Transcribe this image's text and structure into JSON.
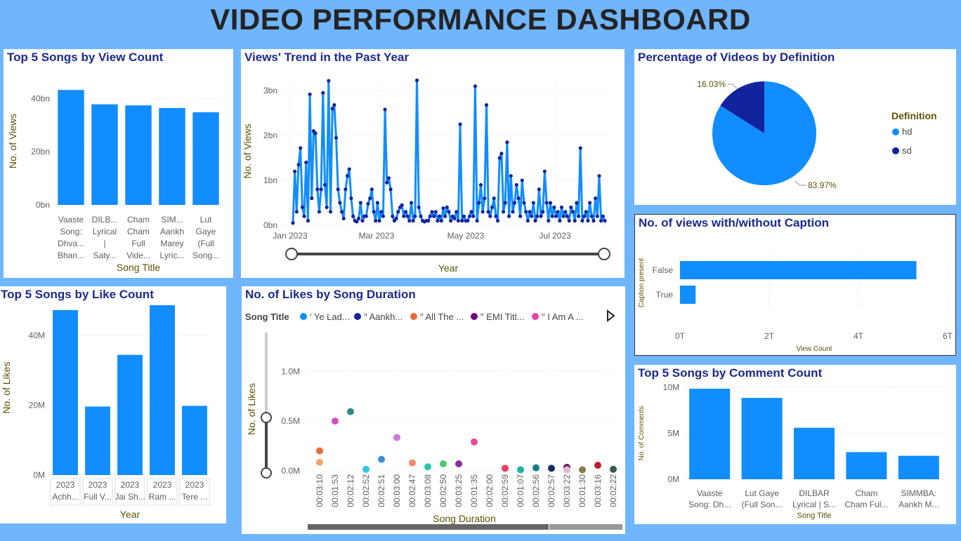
{
  "dashboard": {
    "title": "VIDEO PERFORMANCE DASHBOARD"
  },
  "colors": {
    "bar": "#118dff",
    "dark": "#12239e",
    "background": "#6fb6ff",
    "title": "#1b2a8f"
  },
  "views_panel": {
    "title": "Top 5 Songs by View Count",
    "chart_data": {
      "type": "bar",
      "xlabel": "Song Title",
      "ylabel": "No. of Views",
      "yticks": [
        "0bn",
        "20bn",
        "40bn"
      ],
      "ylim": [
        0,
        48
      ],
      "categories": [
        [
          "Vaaste",
          "Song:",
          "Dhva...",
          "Bhan..."
        ],
        [
          "DILB...",
          "Lyrical",
          "|",
          "Saty..."
        ],
        [
          "Cham",
          "Cham",
          "Full",
          "Vide..."
        ],
        [
          "SIM...",
          "Aankh",
          "Marey",
          "Lyric..."
        ],
        [
          "Lut",
          "Gaye",
          "(Full",
          "Song..."
        ]
      ],
      "values": [
        43.2,
        37.8,
        37.4,
        36.4,
        34.8
      ]
    }
  },
  "trend_panel": {
    "title": "Views' Trend in the Past Year",
    "chart_data": {
      "type": "line",
      "xlabel": "Year",
      "ylabel": "No. of Views",
      "yticks": [
        "0bn",
        "1bn",
        "2bn",
        "3bn"
      ],
      "ylim": [
        0,
        3.3
      ],
      "xticks": [
        "Jan 2023",
        "Mar 2023",
        "May 2023",
        "Jul 2023"
      ],
      "xlim": [
        "2023-01-01",
        "2023-08-05"
      ],
      "values": [
        0.05,
        1.2,
        0.3,
        1.35,
        1.72,
        0.4,
        0.2,
        1.4,
        0.1,
        2.92,
        0.6,
        2.1,
        2.05,
        0.8,
        0.3,
        0.8,
        2.95,
        0.9,
        0.4,
        3.22,
        0.3,
        2.6,
        2.68,
        1.95,
        0.8,
        0.5,
        0.3,
        0.15,
        0.8,
        1.1,
        1.25,
        0.6,
        0.2,
        0.1,
        0.08,
        0.15,
        0.5,
        0.1,
        0.2,
        0.2,
        0.48,
        0.6,
        0.8,
        0.3,
        0.1,
        0.5,
        0.1,
        0.3,
        0.2,
        2.58,
        0.95,
        1.05,
        0.8,
        0.2,
        0.1,
        0.15,
        0.3,
        0.4,
        0.45,
        0.2,
        0.3,
        0.2,
        0.1,
        0.5,
        0.1,
        0.2,
        3.23,
        0.4,
        0.2,
        0.1,
        0.08,
        0.1,
        0.1,
        0.2,
        0.3,
        0.2,
        0.3,
        0.1,
        0.2,
        0.1,
        0.38,
        0.2,
        0.4,
        0.3,
        0.1,
        0.2,
        0.15,
        0.3,
        0.1,
        2.25,
        0.1,
        0.2,
        0.1,
        0.1,
        0.2,
        0.3,
        0.2,
        3.1,
        0.1,
        0.5,
        0.9,
        0.3,
        0.6,
        2.68,
        0.3,
        0.2,
        0.4,
        0.6,
        0.2,
        0.1,
        1.5,
        1.6,
        0.3,
        0.5,
        1.85,
        0.2,
        1.1,
        0.3,
        0.5,
        0.9,
        0.6,
        0.2,
        1.0,
        0.5,
        0.3,
        0.1,
        0.3,
        0.2,
        0.5,
        0.1,
        0.2,
        0.8,
        0.2,
        0.3,
        1.2,
        0.5,
        0.1,
        0.5,
        0.2,
        0.4,
        0.2,
        0.3,
        0.1,
        0.4,
        0.2,
        0.3,
        0.2,
        0.1,
        0.4,
        0.3,
        0.1,
        0.5,
        0.2,
        1.72,
        0.1,
        0.2,
        0.3,
        0.1,
        0.5,
        0.2,
        0.1,
        0.6,
        0.2,
        1.1,
        0.1,
        0.2,
        0.1
      ]
    }
  },
  "definition_panel": {
    "title": "Percentage of Videos by Definition",
    "legend_title": "Definition",
    "chart_data": {
      "type": "pie",
      "labels": [
        "hd",
        "sd"
      ],
      "values": [
        83.97,
        16.03
      ],
      "value_labels": [
        "83.97%",
        "16.03%"
      ],
      "colors": [
        "#118dff",
        "#12239e"
      ]
    }
  },
  "caption_panel": {
    "title": "No. of views with/without Caption",
    "chart_data": {
      "type": "bar",
      "orientation": "horizontal",
      "xlabel": "View Count",
      "ylabel": "Caption present",
      "categories": [
        "False",
        "True"
      ],
      "values": [
        5.3,
        0.35
      ],
      "xticks": [
        "0T",
        "2T",
        "4T",
        "6T"
      ],
      "xlim": [
        0,
        6
      ]
    }
  },
  "likes_panel": {
    "title": "Top 5 Songs by Like Count",
    "chart_data": {
      "type": "bar",
      "xlabel": "Year",
      "ylabel": "No. of Likes",
      "yticks": [
        "0M",
        "20M",
        "40M"
      ],
      "ylim": [
        0,
        50
      ],
      "categories": [
        [
          "2023",
          "Achh..."
        ],
        [
          "2023",
          "Full V..."
        ],
        [
          "2023",
          "Jai Sh..."
        ],
        [
          "2023",
          "Ram ..."
        ],
        [
          "2023",
          "Tere ..."
        ]
      ],
      "values": [
        47.2,
        19.6,
        34.4,
        48.6,
        19.8
      ]
    }
  },
  "duration_panel": {
    "title": "No. of Likes by Song Duration",
    "legend_title": "Song Title",
    "legend": [
      {
        "label": "' Ye Lad...",
        "color": "#118dff"
      },
      {
        "label": "\" Aankh...",
        "color": "#12239e"
      },
      {
        "label": "\" All The ...",
        "color": "#e66c37"
      },
      {
        "label": "\" EMI Titl...",
        "color": "#6b007b"
      },
      {
        "label": "\" I Am A ...",
        "color": "#e044a7"
      }
    ],
    "chart_data": {
      "type": "scatter",
      "xlabel": "Song Duration",
      "ylabel": "No. of Likes",
      "yticks": [
        "0.0M",
        "0.5M",
        "1.0M"
      ],
      "ylim": [
        -0.05,
        1.15
      ],
      "categories": [
        "00:03:10",
        "00:01:53",
        "00:02:12",
        "00:02:52",
        "00:02:51",
        "00:03:00",
        "00:02:47",
        "00:03:08",
        "00:02:50",
        "00:03:25",
        "00:01:35",
        "00:02:00",
        "00:02:59",
        "00:01:07",
        "00:02:56",
        "00:02:57",
        "00:03:22",
        "00:01:30",
        "00:03:16",
        "00:02:22"
      ],
      "points": [
        {
          "x": 0,
          "y": 0.2,
          "color": "#e66c37"
        },
        {
          "x": 0,
          "y": 0.085,
          "color": "#f5a36b"
        },
        {
          "x": 1,
          "y": 0.5,
          "color": "#d64fc2"
        },
        {
          "x": 2,
          "y": 0.595,
          "color": "#2d8a8a"
        },
        {
          "x": 3,
          "y": 0.015,
          "color": "#34c6e8"
        },
        {
          "x": 4,
          "y": 0.115,
          "color": "#3c8ddc"
        },
        {
          "x": 5,
          "y": 0.335,
          "color": "#c77dd6"
        },
        {
          "x": 6,
          "y": 0.08,
          "color": "#f08a6a"
        },
        {
          "x": 7,
          "y": 0.04,
          "color": "#2bc6b0"
        },
        {
          "x": 8,
          "y": 0.07,
          "color": "#4cc96a"
        },
        {
          "x": 9,
          "y": 0.07,
          "color": "#8a2b9e"
        },
        {
          "x": 10,
          "y": 0.29,
          "color": "#e8489b"
        },
        {
          "x": 12,
          "y": 0.025,
          "color": "#e83e5e"
        },
        {
          "x": 13,
          "y": 0.01,
          "color": "#1fb0a5"
        },
        {
          "x": 14,
          "y": 0.03,
          "color": "#1a7a8a"
        },
        {
          "x": 15,
          "y": 0.025,
          "color": "#1b2a6b"
        },
        {
          "x": 16,
          "y": 0.035,
          "color": "#5b1f6b"
        },
        {
          "x": 16,
          "y": 0.01,
          "color": "#e8b4d0"
        },
        {
          "x": 17,
          "y": 0.01,
          "color": "#8a7a4a"
        },
        {
          "x": 18,
          "y": 0.055,
          "color": "#b81d2e"
        },
        {
          "x": 19,
          "y": 0.015,
          "color": "#3a5a5a"
        }
      ]
    }
  },
  "comments_panel": {
    "title": "Top 5 Songs by Comment Count",
    "chart_data": {
      "type": "bar",
      "xlabel": "Song Title",
      "ylabel": "No. of Comments",
      "yticks": [
        "0M",
        "5M",
        "10M"
      ],
      "ylim": [
        0,
        10
      ],
      "categories": [
        [
          "Vaaste",
          "Song: Dh..."
        ],
        [
          "Lut Gaye",
          "(Full Son..."
        ],
        [
          "DILBAR",
          "Lyrical | S..."
        ],
        [
          "Cham",
          "Cham Ful..."
        ],
        [
          "SIMMBA:",
          "Aankh M..."
        ]
      ],
      "values": [
        9.85,
        8.85,
        5.6,
        2.95,
        2.55
      ]
    }
  }
}
